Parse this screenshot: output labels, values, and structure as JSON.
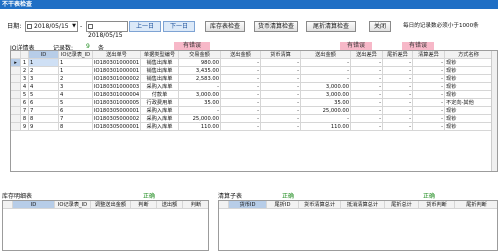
{
  "window": {
    "title": "不干表检查"
  },
  "toolbar": {
    "date_label": "日期:",
    "date_from": "2018/05/15",
    "date_to": "2018/05/15",
    "prev_day": "上一日",
    "next_day": "下一日",
    "inventory_check": "库存表检查",
    "payment_check": "货币清算检查",
    "tail_check": "尾折清算检查",
    "close": "关闭",
    "daily_note": "每日的记录数必须小于1000条"
  },
  "main": {
    "list_label": "IO详情表",
    "record_count_label": "记录数:",
    "record_count": "9",
    "record_count_unit": "条",
    "tags": [
      "有错误",
      "有错误",
      "有错误"
    ],
    "columns": [
      "ID",
      "IO记录表_ID",
      "送出单号",
      "单据类型编号",
      "交易金额",
      "送出金额",
      "货币清算",
      "送出金额",
      "送出差异",
      "尾折差异",
      "清算差异",
      "方式名称"
    ],
    "rows": [
      [
        "1",
        "1",
        "IO180301000001",
        "销售出库单",
        "980.00",
        "-",
        "-",
        "-",
        "-",
        "-",
        "-",
        "现钞"
      ],
      [
        "2",
        "1",
        "IO180301000001",
        "销售出库单",
        "3,435.00",
        "-",
        "-",
        "-",
        "-",
        "-",
        "-",
        "现钞"
      ],
      [
        "3",
        "2",
        "IO180301000002",
        "销售出库单",
        "2,583.00",
        "-",
        "-",
        "-",
        "-",
        "-",
        "-",
        "现钞"
      ],
      [
        "4",
        "3",
        "IO180301000003",
        "采购入库单",
        "-",
        "-",
        "-",
        "3,000.00",
        "-",
        "-",
        "-",
        "现钞"
      ],
      [
        "5",
        "4",
        "IO180301000004",
        "付款单",
        "3,000.00",
        "-",
        "-",
        "3,000.00",
        "-",
        "-",
        "-",
        "现钞"
      ],
      [
        "6",
        "5",
        "IO180301000005",
        "行政费用单",
        "35.00",
        "-",
        "-",
        "35.00",
        "-",
        "-",
        "-",
        "不定向-其他"
      ],
      [
        "7",
        "6",
        "IO180305000001",
        "采购入库单",
        "-",
        "-",
        "-",
        "25,000.00",
        "-",
        "-",
        "-",
        "现钞"
      ],
      [
        "8",
        "7",
        "IO180305000002",
        "采购入库单",
        "25,000.00",
        "-",
        "-",
        "-",
        "-",
        "-",
        "-",
        "现钞"
      ],
      [
        "9",
        "8",
        "IO180305000001",
        "采购入库单",
        "110.00",
        "-",
        "-",
        "110.00",
        "-",
        "-",
        "-",
        "现钞"
      ]
    ]
  },
  "inventory_panel": {
    "label": "库存明细表",
    "status": "正确",
    "columns": [
      "ID",
      "IO记录表_ID",
      "调整送出金额",
      "判断",
      "送出额",
      "判断"
    ]
  },
  "clearing_panel": {
    "label": "清算子表",
    "status": "正确",
    "status2": "正确",
    "columns": [
      "货币ID",
      "尾折ID",
      "货币清算总计",
      "抵消清算总计",
      "尾折总计",
      "货币判断",
      "尾折判断"
    ]
  }
}
